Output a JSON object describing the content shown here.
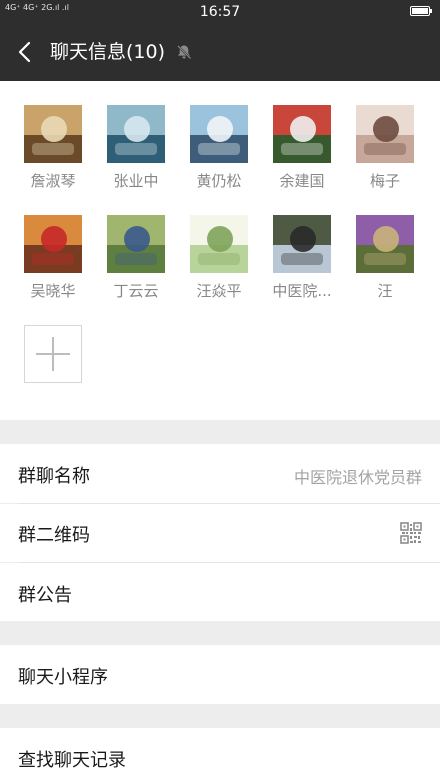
{
  "status_bar": {
    "signal_text": "4G⁺ 4G⁺ 2G.ıl .ıl",
    "time": "16:57"
  },
  "nav": {
    "title": "聊天信息(10)",
    "back_icon": "chevron-left-icon",
    "mute_icon": "bell-muted-icon"
  },
  "members": [
    {
      "name": "詹淑琴",
      "colors": [
        "#6b4a2a",
        "#c9a36a",
        "#e8d9b5"
      ]
    },
    {
      "name": "张业中",
      "colors": [
        "#2f5f77",
        "#8fb9c9",
        "#d7e8ef"
      ]
    },
    {
      "name": "黄仍松",
      "colors": [
        "#3e5d7a",
        "#9cc3dd",
        "#f1f5f7"
      ]
    },
    {
      "name": "余建国",
      "colors": [
        "#365a2d",
        "#c9473a",
        "#eeeeee"
      ]
    },
    {
      "name": "梅子",
      "colors": [
        "#c7a79a",
        "#eadbd2",
        "#6e4b3f"
      ]
    },
    {
      "name": "吴晓华",
      "colors": [
        "#7a3b23",
        "#d98a3d",
        "#c62828"
      ]
    },
    {
      "name": "丁云云",
      "colors": [
        "#5e7f3f",
        "#a0b56d",
        "#3b5a8c"
      ]
    },
    {
      "name": "汪焱平",
      "colors": [
        "#b9d49a",
        "#f3f6e9",
        "#7fa35b"
      ]
    },
    {
      "name": "中医院...",
      "colors": [
        "#b8c7d3",
        "#4e5a44",
        "#2a2a2a"
      ]
    },
    {
      "name": "汪",
      "colors": [
        "#5b6e3a",
        "#8f5ea8",
        "#c9b27a"
      ]
    }
  ],
  "add_member": {
    "icon": "plus-icon"
  },
  "group_name": {
    "label": "群聊名称",
    "value": "中医院退休党员群"
  },
  "group_qr": {
    "label": "群二维码",
    "icon": "qr-code-icon"
  },
  "group_notice": {
    "label": "群公告"
  },
  "mini_programs": {
    "label": "聊天小程序"
  },
  "search_history": {
    "label": "查找聊天记录"
  }
}
